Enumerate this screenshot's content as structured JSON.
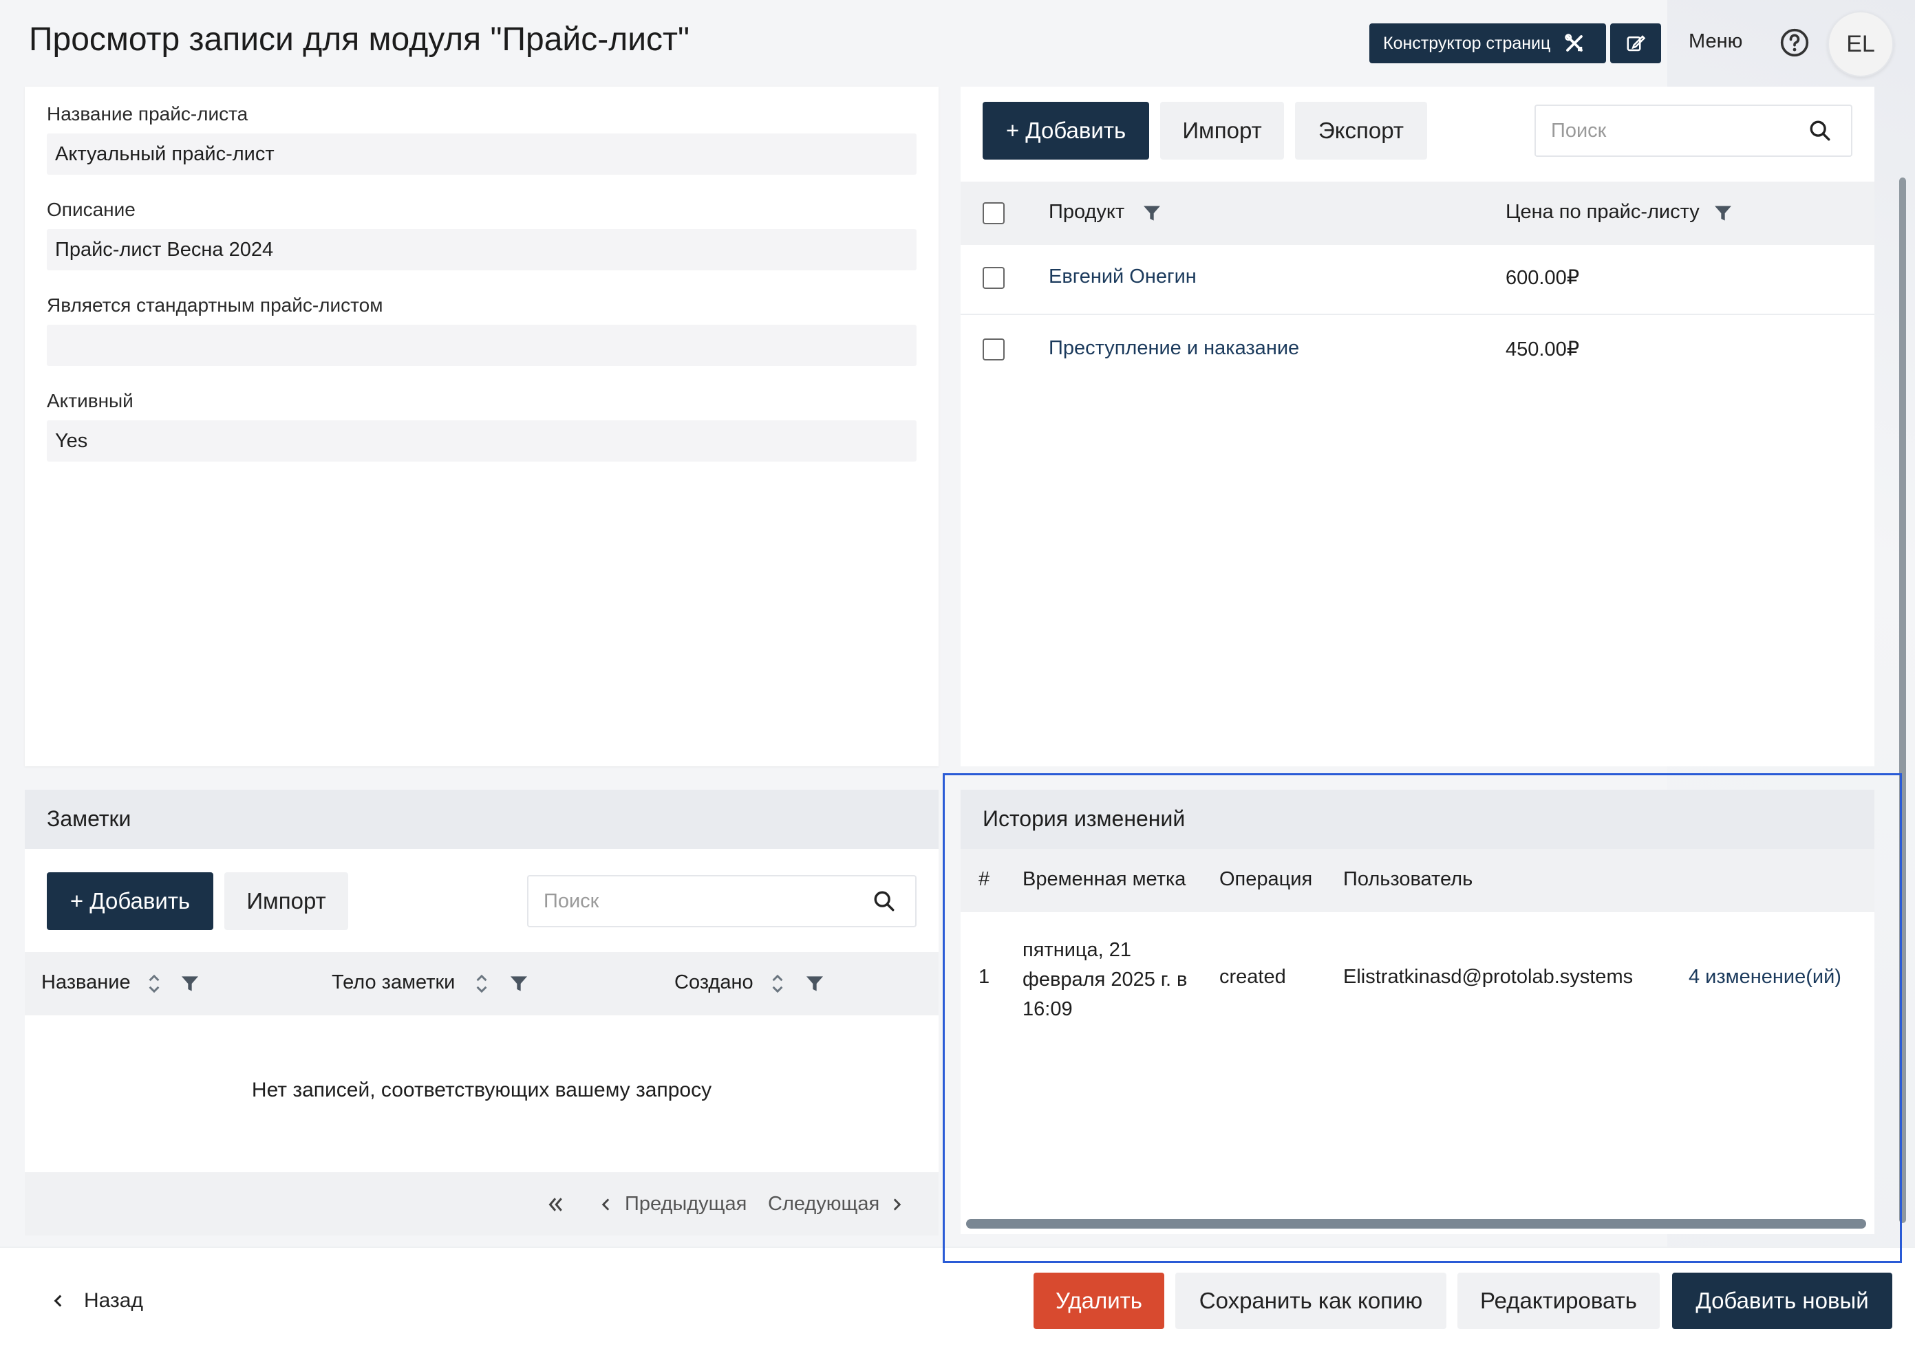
{
  "header": {
    "title": "Просмотр записи для модуля \"Прайс-лист\"",
    "constructor_label": "Конструктор страниц",
    "menu_label": "Меню",
    "avatar_initials": "EL"
  },
  "details": {
    "fields": [
      {
        "label": "Название прайс-листа",
        "value": "Актуальный прайс-лист"
      },
      {
        "label": "Описание",
        "value": "Прайс-лист Весна 2024"
      },
      {
        "label": "Является стандартным прайс-листом",
        "value": ""
      },
      {
        "label": "Активный",
        "value": "Yes"
      }
    ]
  },
  "products": {
    "add_label": "+ Добавить",
    "import_label": "Импорт",
    "export_label": "Экспорт",
    "search_placeholder": "Поиск",
    "columns": [
      "Продукт",
      "Цена по прайс-листу"
    ],
    "rows": [
      {
        "product": "Евгений Онегин",
        "price": "600.00₽"
      },
      {
        "product": "Преступление и наказание",
        "price": "450.00₽"
      }
    ]
  },
  "notes": {
    "title": "Заметки",
    "add_label": "+ Добавить",
    "import_label": "Импорт",
    "search_placeholder": "Поиск",
    "columns": [
      "Название",
      "Тело заметки",
      "Создано"
    ],
    "empty_message": "Нет записей, соответствующих вашему запросу",
    "prev_label": "Предыдущая",
    "next_label": "Следующая"
  },
  "history": {
    "title": "История изменений",
    "columns": [
      "#",
      "Временная метка",
      "Операция",
      "Пользователь"
    ],
    "rows": [
      {
        "num": "1",
        "timestamp_lines": [
          "пятница, 21",
          "февраля 2025 г. в",
          "16:09"
        ],
        "operation": "created",
        "user": "Elistratkinasd@protolab.systems",
        "changes": "4 изменение(ий)"
      }
    ]
  },
  "footer": {
    "back_label": "Назад",
    "delete_label": "Удалить",
    "save_copy_label": "Сохранить как копию",
    "edit_label": "Редактировать",
    "add_new_label": "Добавить новый"
  },
  "colors": {
    "primary": "#1a3148",
    "danger": "#d84a2f",
    "highlight": "#2a5bd6"
  }
}
